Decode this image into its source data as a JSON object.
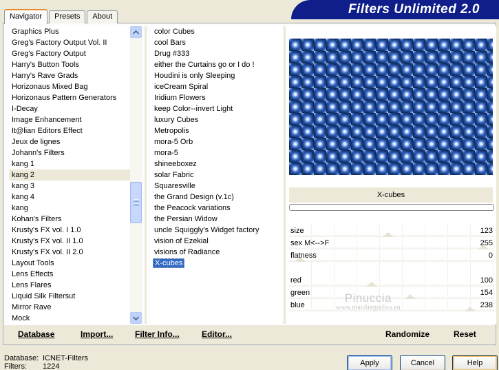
{
  "tabs": [
    "Navigator",
    "Presets",
    "About"
  ],
  "banner_title": "Filters Unlimited 2.0",
  "categories": [
    "Graphics Plus",
    "Greg's Factory Output Vol. II",
    "Greg's Factory Output",
    "Harry's Button Tools",
    "Harry's Rave Grads",
    "Horizonaus Mixed Bag",
    "Horizonaus Pattern Generators",
    "I-Decay",
    "Image Enhancement",
    "It@lian Editors Effect",
    "Jeux de lignes",
    "Johann's Filters",
    "kang 1",
    "kang 2",
    "kang 3",
    "kang 4",
    "kang",
    "Kohan's Filters",
    "Krusty's FX vol. I 1.0",
    "Krusty's FX vol. II 1.0",
    "Krusty's FX vol. II 2.0",
    "Layout Tools",
    "Lens Effects",
    "Lens Flares",
    "Liquid Silk Filtersut",
    "Mirror Rave",
    "Mock"
  ],
  "selected_category": "kang 2",
  "filters": [
    "color Cubes",
    "cool Bars",
    "Drug #333",
    "either the Curtains go or I do !",
    "Houdini is only Sleeping",
    "iceCream Spiral",
    "Iridium Flowers",
    "keep Color--invert Light",
    "luxury Cubes",
    "Metropolis",
    "mora-5 Orb",
    "mora-5",
    "shineeboxez",
    "solar Fabric",
    "Squaresville",
    "the Grand Design     (v.1c)",
    "the Peacock variations",
    "the Persian Widow",
    "uncle Squiggly's Widget factory",
    "vision of Ezekial",
    "visions of Radiance",
    "X-cubes"
  ],
  "selected_filter": "X-cubes",
  "filter_name": "X-cubes",
  "params": [
    {
      "label": "size",
      "value": "123"
    },
    {
      "label": "sex  M<-->F",
      "value": "255"
    },
    {
      "label": "flatness",
      "value": "0"
    },
    {
      "label": "",
      "value": ""
    },
    {
      "label": "red",
      "value": "100"
    },
    {
      "label": "green",
      "value": "154"
    },
    {
      "label": "blue",
      "value": "238"
    }
  ],
  "param_levels": [
    0.48,
    1.0,
    0.0,
    null,
    0.39,
    0.6,
    0.93
  ],
  "watermark": {
    "name": "Pinuccia",
    "site": "www.maidiregrafica.eu"
  },
  "actions": {
    "database": "Database",
    "import": "Import...",
    "filter_info": "Filter Info...",
    "editor": "Editor...",
    "randomize": "Randomize",
    "reset": "Reset"
  },
  "info": {
    "database_label": "Database:",
    "database_value": "ICNET-Filters",
    "filters_label": "Filters:",
    "filters_value": "1224"
  },
  "buttons": {
    "apply": "Apply",
    "cancel": "Cancel",
    "help": "Help"
  }
}
